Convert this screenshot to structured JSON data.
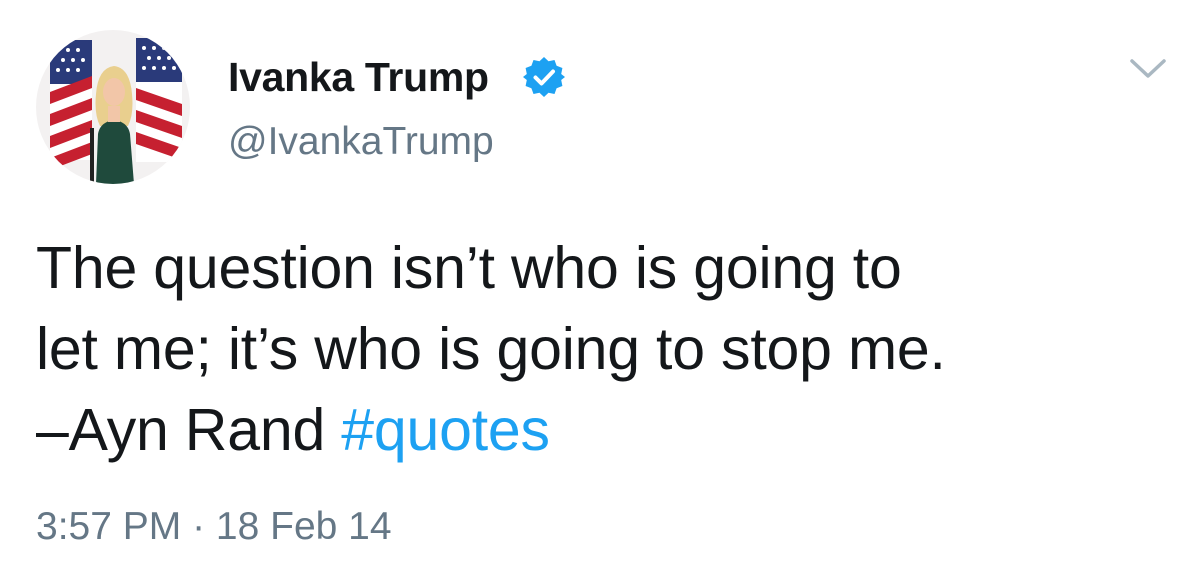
{
  "author": {
    "display_name": "Ivanka Trump",
    "handle": "@IvankaTrump",
    "verified": true,
    "avatar_icon": "profile-photo"
  },
  "tweet": {
    "line1": "The question isn’t who is going to",
    "line2": "let me; it’s who is going to stop me.",
    "line3_text": "–Ayn Rand ",
    "hashtag": "#quotes"
  },
  "meta": {
    "time": "3:57 PM",
    "separator": " · ",
    "date": "18 Feb 14"
  },
  "icons": {
    "verified": "verified-badge-icon",
    "menu": "chevron-down-icon"
  },
  "colors": {
    "text": "#14171a",
    "secondary": "#657786",
    "link": "#1da1f2",
    "verified": "#1da1f2"
  }
}
